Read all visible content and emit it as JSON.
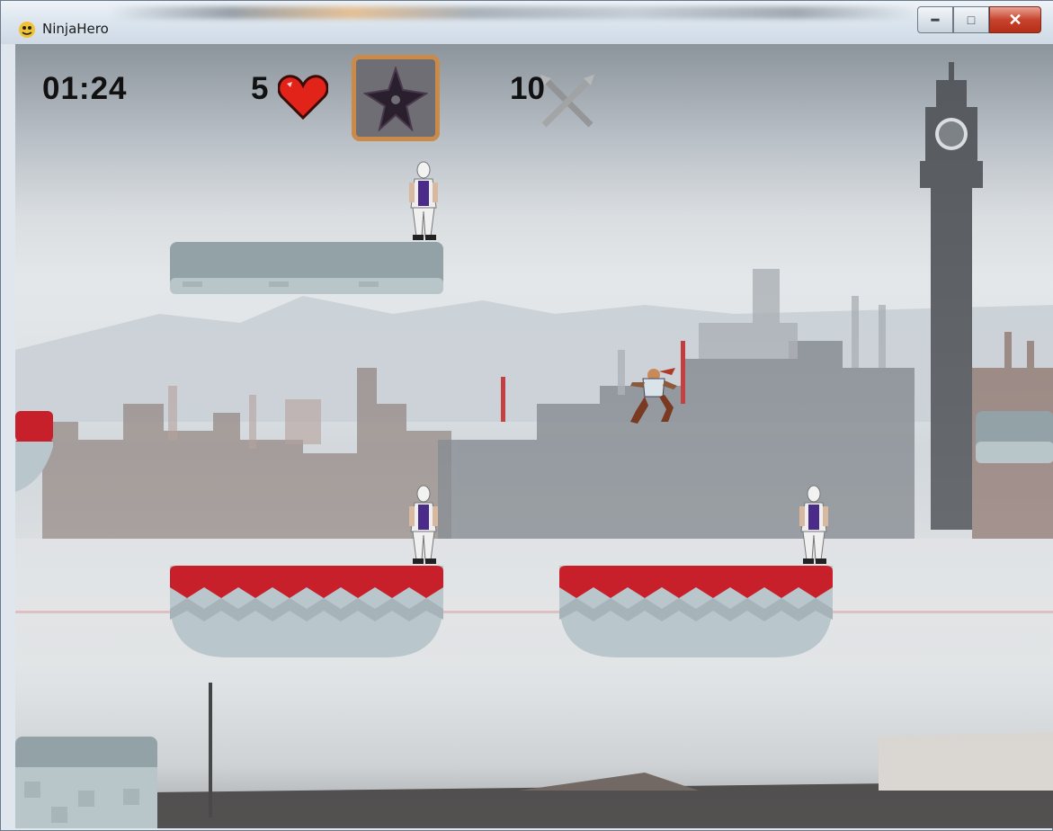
{
  "window": {
    "title": "NinjaHero",
    "icon": "pygame-snake-icon",
    "buttons": {
      "minimize_icon": "minimize-icon",
      "maximize_icon": "maximize-icon",
      "close_icon": "close-icon"
    }
  },
  "hud": {
    "timer": "01:24",
    "lives": "5",
    "lives_icon": "heart-icon",
    "selected_weapon_icon": "shuriken-icon",
    "ammo": "10",
    "ammo_icon": "crossed-kunai-icon"
  },
  "scene": {
    "background": "industrial-city-skyline",
    "player": "ninja-hero-jumping",
    "enemies": [
      "white-ninja-enemy",
      "white-ninja-enemy",
      "white-ninja-enemy"
    ],
    "colors": {
      "platform_red": "#c8202a",
      "platform_ice": "#b9c6cc",
      "slot_border": "#c98a4a",
      "heart": "#e2231a"
    }
  }
}
